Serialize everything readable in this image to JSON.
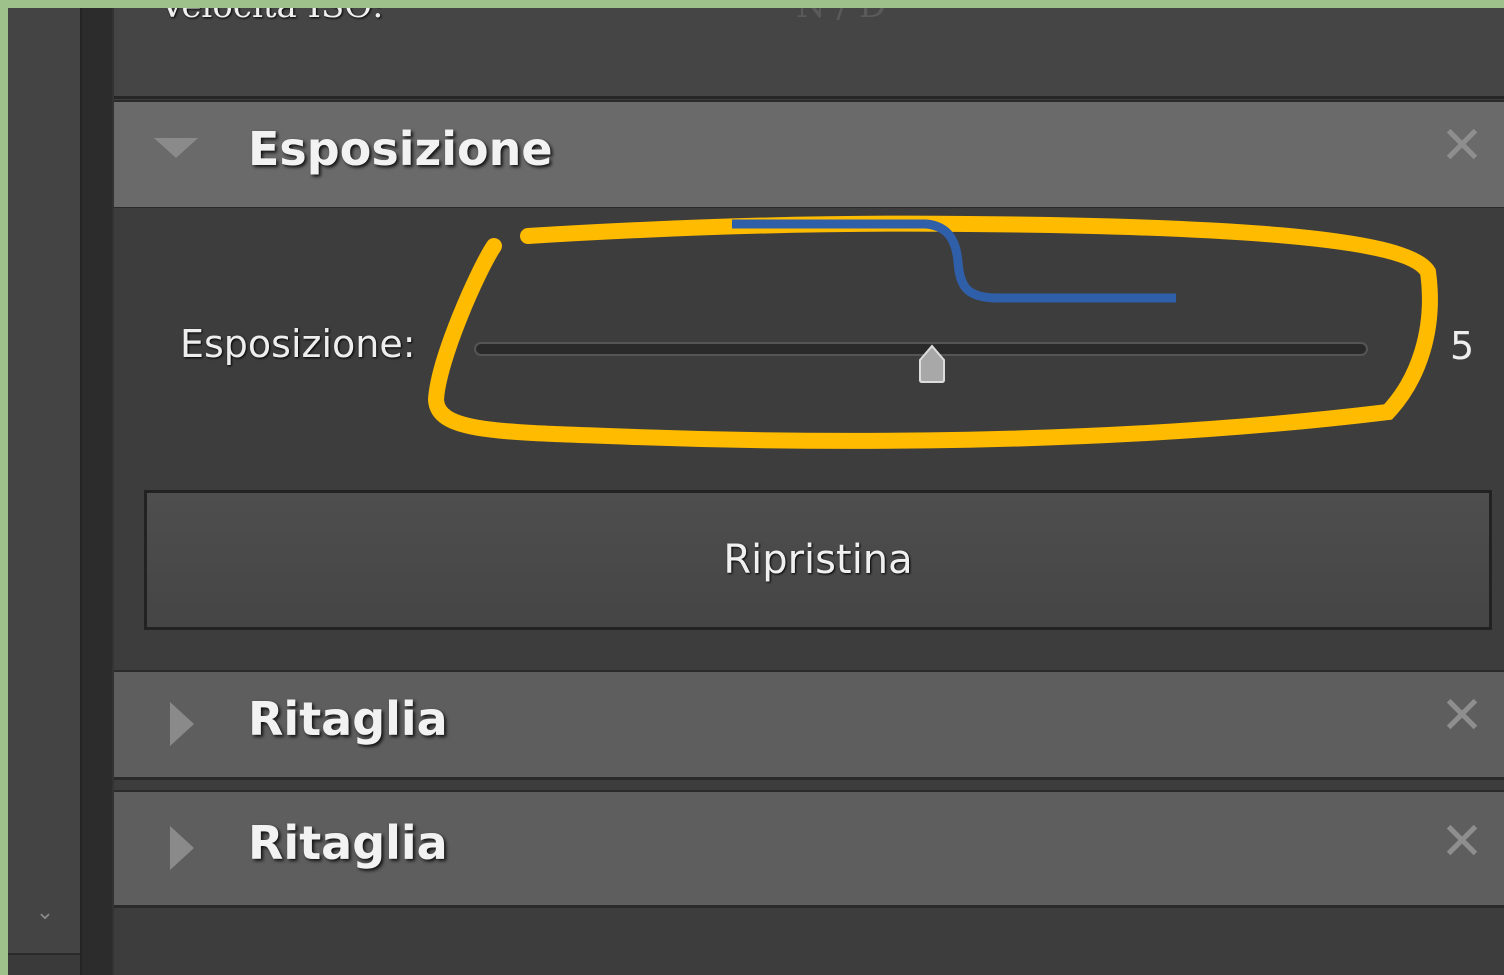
{
  "iso": {
    "label": "Velocità ISO:",
    "value": "N / D"
  },
  "sections": [
    {
      "title": "Esposizione",
      "expanded": true
    },
    {
      "title": "Ritaglia",
      "expanded": false
    },
    {
      "title": "Ritaglia",
      "expanded": false
    }
  ],
  "exposure": {
    "label": "Esposizione:",
    "value": "5",
    "slider_fraction": 0.5
  },
  "reset_button": {
    "label": "Ripristina"
  },
  "icons": {
    "close": "close-icon",
    "expand": "triangle-down-icon",
    "collapse": "triangle-right-icon",
    "scroll": "chevron-down-icon"
  },
  "colors": {
    "highlight": "#ffbb00",
    "annotation_line": "#2f5fa8"
  }
}
